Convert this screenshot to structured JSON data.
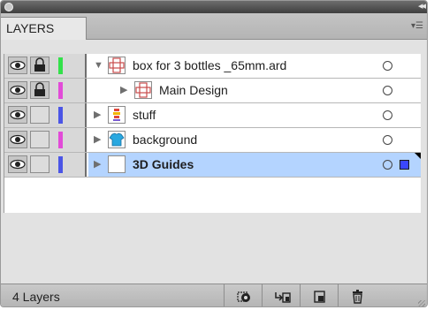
{
  "panel": {
    "tab_label": "LAYERS",
    "colors": {
      "selection": "#b4d4ff",
      "target_square": "#3b47ff"
    }
  },
  "layers": [
    {
      "name": "box for 3 bottles _65mm.ard",
      "bold": false,
      "expanded": true,
      "locked": true,
      "swatch": "#33e14a",
      "thumb": "box-grid-icon",
      "selected": false
    },
    {
      "name": "Main Design",
      "bold": false,
      "expanded": false,
      "locked": true,
      "swatch": "#e24bd8",
      "thumb": "box-grid-icon",
      "selected": false
    },
    {
      "name": "stuff",
      "bold": false,
      "expanded": false,
      "locked": false,
      "swatch": "#4b55e6",
      "thumb": "artwork-icon",
      "selected": false
    },
    {
      "name": "background",
      "bold": false,
      "expanded": false,
      "locked": false,
      "swatch": "#e24bd8",
      "thumb": "shirt-icon",
      "selected": false
    },
    {
      "name": "3D Guides",
      "bold": true,
      "expanded": false,
      "locked": false,
      "swatch": "#4b55e6",
      "thumb": "blank-icon",
      "selected": true
    }
  ],
  "footer": {
    "count_label": "4 Layers",
    "buttons": [
      "make-clip-mask-icon",
      "create-sublayer-icon",
      "new-layer-icon",
      "trash-icon"
    ]
  }
}
